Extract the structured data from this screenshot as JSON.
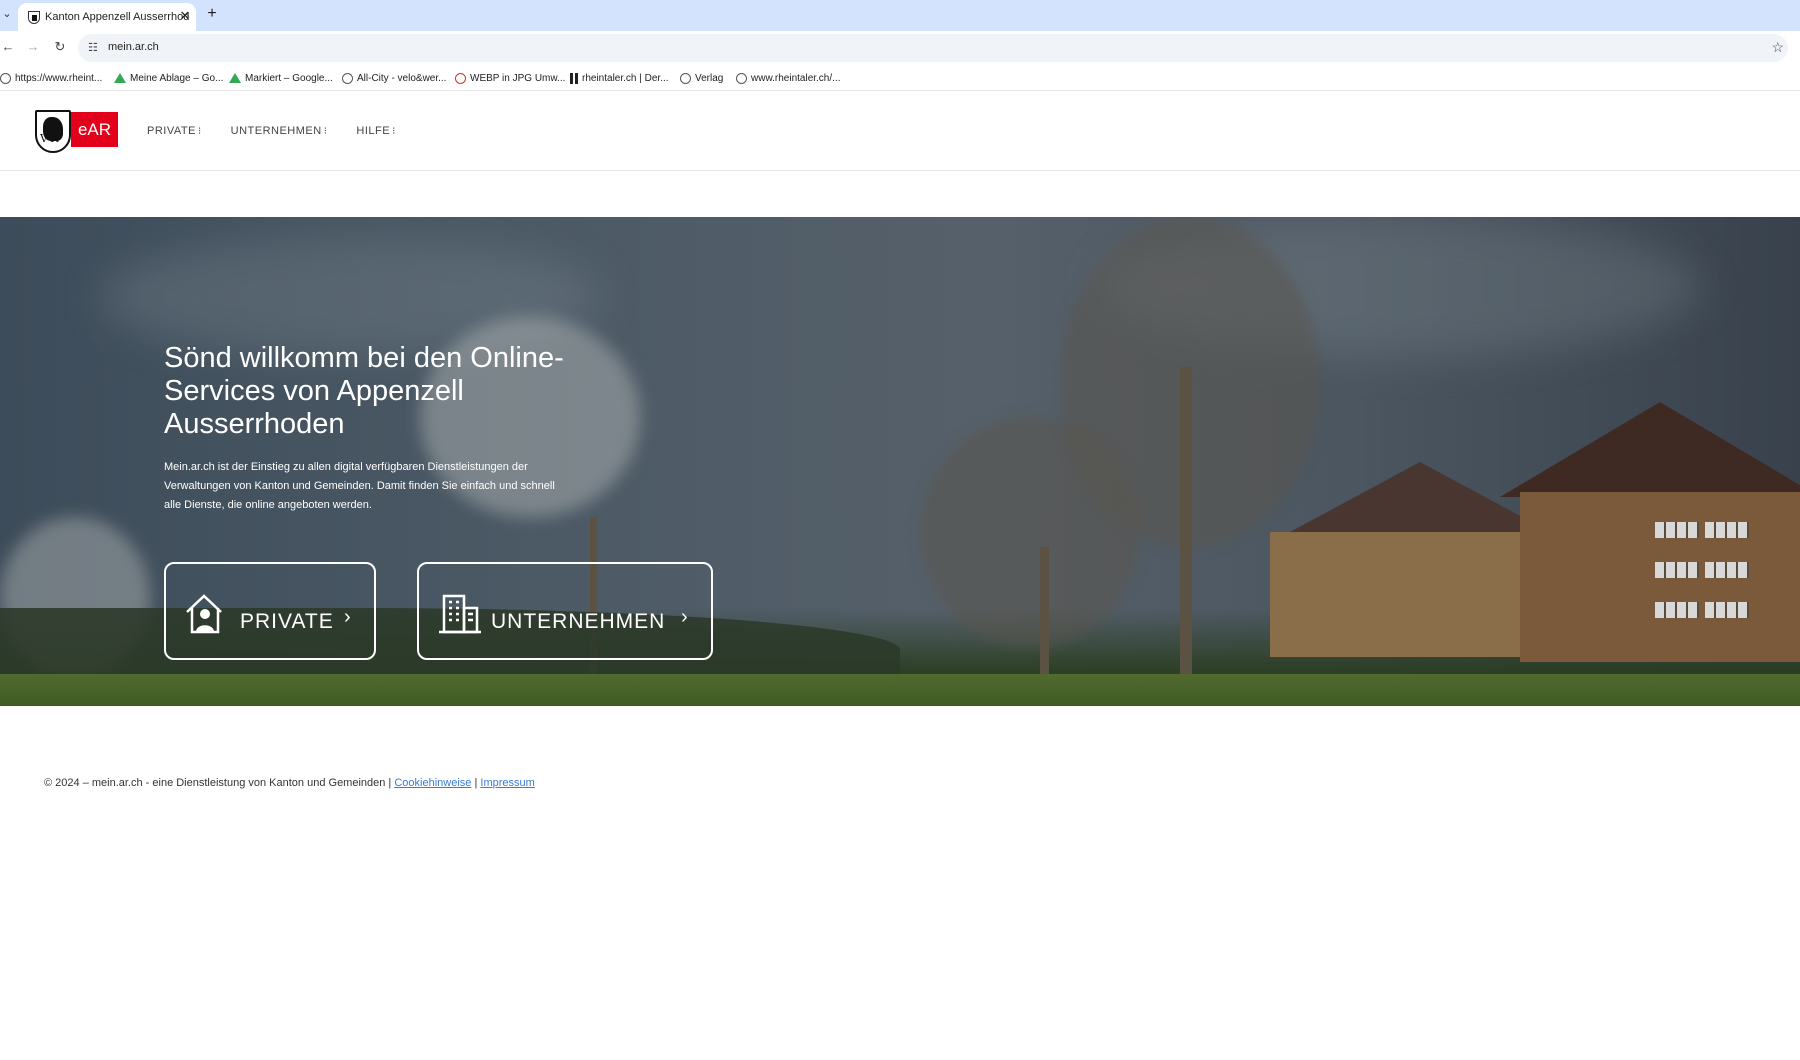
{
  "browser": {
    "tab_title": "Kanton Appenzell Ausserrhoden",
    "tab_close": "✕",
    "new_tab": "+",
    "url": "mein.ar.ch",
    "bookmarks": [
      {
        "label": "https://www.rheint...",
        "icon": "globe-icon"
      },
      {
        "label": "Meine Ablage – Go...",
        "icon": "drive-icon"
      },
      {
        "label": "Markiert – Google...",
        "icon": "drive-icon"
      },
      {
        "label": "All-City - velo&wer...",
        "icon": "globe-icon"
      },
      {
        "label": "WEBP in JPG Umw...",
        "icon": "webp-icon"
      },
      {
        "label": "rheintaler.ch | Der...",
        "icon": "rheintaler-icon"
      },
      {
        "label": "Verlag",
        "icon": "globe-icon"
      },
      {
        "label": "www.rheintaler.ch/...",
        "icon": "globe-icon"
      }
    ]
  },
  "site": {
    "logo_text": "eAR",
    "logo_shield_letters": "VR",
    "nav": [
      {
        "label": "PRIVATE"
      },
      {
        "label": "UNTERNEHMEN"
      },
      {
        "label": "HILFE"
      }
    ],
    "hero": {
      "title": "Sönd willkomm bei den Online-Services von Appenzell Ausserrhoden",
      "text": "Mein.ar.ch ist der Einstieg zu allen digital verfügbaren Dienstleistungen der Verwaltungen von Kanton und Gemeinden. Damit finden Sie einfach und schnell alle Dienste, die online angeboten werden.",
      "cta_private": "PRIVATE",
      "cta_unternehmen": "UNTERNEHMEN"
    },
    "footer": {
      "text": "© 2024 – mein.ar.ch - eine Dienstleistung von Kanton und Gemeinden |",
      "link_cookies": "Cookiehinweise",
      "separator": "|",
      "link_impressum": "Impressum"
    }
  },
  "colors": {
    "brand_red": "#e2001a",
    "tabbar": "#d3e3fd",
    "link": "#3a7bd5"
  }
}
